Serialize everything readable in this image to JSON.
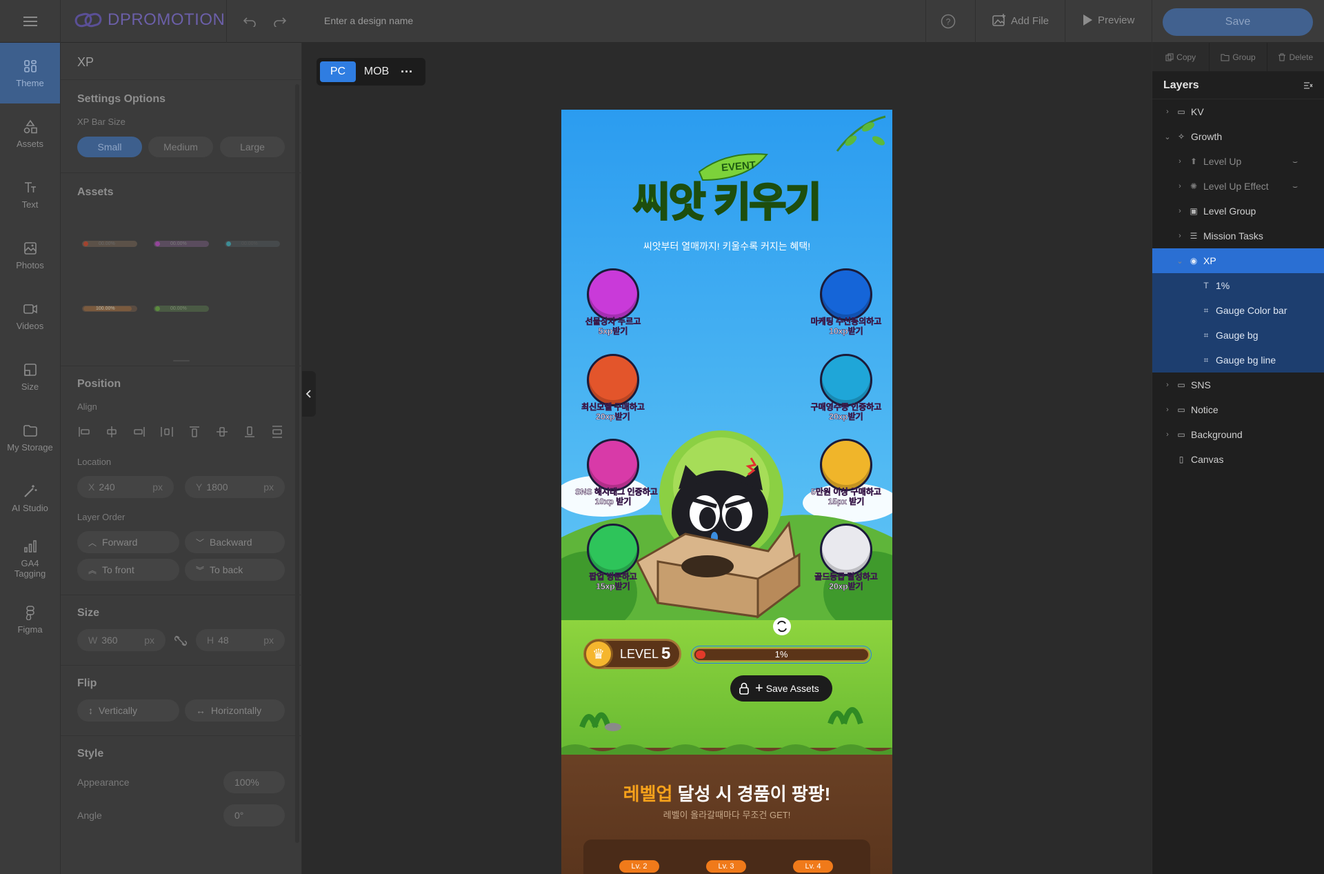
{
  "topbar": {
    "logo": "DPROMOTION",
    "design_name_placeholder": "Enter a design name",
    "add_file": "Add File",
    "preview": "Preview",
    "save": "Save"
  },
  "nav": [
    {
      "label": "Theme",
      "icon": "theme-icon"
    },
    {
      "label": "Assets",
      "icon": "assets-icon"
    },
    {
      "label": "Text",
      "icon": "text-icon"
    },
    {
      "label": "Photos",
      "icon": "photos-icon"
    },
    {
      "label": "Videos",
      "icon": "videos-icon"
    },
    {
      "label": "Size",
      "icon": "size-icon"
    },
    {
      "label": "My Storage",
      "icon": "folder-icon"
    },
    {
      "label": "AI Studio",
      "icon": "wand-icon"
    },
    {
      "label": "GA4 Tagging",
      "icon": "chart-icon"
    },
    {
      "label": "Figma",
      "icon": "figma-icon"
    }
  ],
  "panel": {
    "title": "XP",
    "settings_title": "Settings Options",
    "xp_bar_size_label": "XP Bar Size",
    "sizes": [
      "Small",
      "Medium",
      "Large"
    ],
    "selected_size": "Small",
    "assets_title": "Assets",
    "asset_labels": [
      "00.00%",
      "00.00%",
      "00.00%",
      "100.00%",
      "00.00%"
    ],
    "position_title": "Position",
    "align_label": "Align",
    "location_label": "Location",
    "x_label": "X",
    "x_value": "240",
    "y_label": "Y",
    "y_value": "1800",
    "unit": "px",
    "layer_order_label": "Layer Order",
    "forward": "Forward",
    "backward": "Backward",
    "to_front": "To front",
    "to_back": "To back",
    "size_title": "Size",
    "w_label": "W",
    "w_value": "360",
    "h_label": "H",
    "h_value": "48",
    "flip_title": "Flip",
    "vertically": "Vertically",
    "horizontally": "Horizontally",
    "style_title": "Style",
    "appearance_label": "Appearance",
    "appearance_value": "100%",
    "angle_label": "Angle",
    "angle_value": "0°"
  },
  "canvas": {
    "tab_pc": "PC",
    "tab_mob": "MOB",
    "more": "···"
  },
  "artboard": {
    "event": "EVENT",
    "title": "씨앗 키우기",
    "subtitle": "씨앗부터 열매까지! 키울수록 커지는 혜택!",
    "missions": [
      {
        "line1": "선물상자 누르고",
        "line2": "5xp받기",
        "color": "#c93ad9"
      },
      {
        "line1": "마케팅 수신동의하고",
        "line2": "10xp받기",
        "color": "#1565d8"
      },
      {
        "line1": "최신모델 구매하고",
        "line2": "20xp받기",
        "color": "#e3552b"
      },
      {
        "line1": "구매영수증 인증하고",
        "line2": "20xp받기",
        "color": "#1fa6d8"
      },
      {
        "line1": "SNS 해시태그 인증하고",
        "line2": "10xp 받기",
        "color": "#d83aa8"
      },
      {
        "line1": "5만원 이상 구매하고",
        "line2": "15px 받기",
        "color": "#f0b52a"
      },
      {
        "line1": "팝업 방문하고",
        "line2": "15xp받기",
        "color": "#2ec45a"
      },
      {
        "line1": "골드등급 달성하고",
        "line2": "20xp받기",
        "color": "#e9e9ee"
      }
    ],
    "level_text": "LEVEL",
    "level_num": "5",
    "xp_percent": "1%",
    "xp_fill": 0.01,
    "save_assets": "Save Assets",
    "reward_title_highlight": "레벨업",
    "reward_title_rest": " 달성 시 경품이 팡팡!",
    "reward_sub": "레벨이 올라갈때마다 무조건 GET!",
    "reward_levels": [
      "Lv. 2",
      "Lv. 3",
      "Lv. 4"
    ]
  },
  "right": {
    "copy": "Copy",
    "group": "Group",
    "delete": "Delete",
    "layers_title": "Layers",
    "layers": [
      {
        "label": "KV",
        "depth": 0,
        "chev": "›",
        "icon": "folder-icon",
        "state": ""
      },
      {
        "label": "Growth",
        "depth": 0,
        "chev": "⌄",
        "icon": "sparkle-icon",
        "state": ""
      },
      {
        "label": "Level Up",
        "depth": 1,
        "chev": "›",
        "icon": "levelup-icon",
        "state": "dim"
      },
      {
        "label": "Level Up Effect",
        "depth": 1,
        "chev": "›",
        "icon": "effect-icon",
        "state": "dim"
      },
      {
        "label": "Level Group",
        "depth": 1,
        "chev": "›",
        "icon": "level-group-icon",
        "state": ""
      },
      {
        "label": "Mission Tasks",
        "depth": 1,
        "chev": "›",
        "icon": "list-icon",
        "state": ""
      },
      {
        "label": "XP",
        "depth": 1,
        "chev": "⌄",
        "icon": "xp-icon",
        "state": "sel"
      },
      {
        "label": "1%",
        "depth": 2,
        "chev": "",
        "icon": "text-icon",
        "state": "child"
      },
      {
        "label": "Gauge Color bar",
        "depth": 2,
        "chev": "",
        "icon": "frame-icon",
        "state": "child"
      },
      {
        "label": "Gauge bg",
        "depth": 2,
        "chev": "",
        "icon": "frame-icon",
        "state": "child"
      },
      {
        "label": "Gauge bg line",
        "depth": 2,
        "chev": "",
        "icon": "frame-icon",
        "state": "child"
      },
      {
        "label": "SNS",
        "depth": 0,
        "chev": "›",
        "icon": "folder-icon",
        "state": ""
      },
      {
        "label": "Notice",
        "depth": 0,
        "chev": "›",
        "icon": "folder-icon",
        "state": ""
      },
      {
        "label": "Background",
        "depth": 0,
        "chev": "›",
        "icon": "folder-icon",
        "state": ""
      },
      {
        "label": "Canvas",
        "depth": 0,
        "chev": "",
        "icon": "canvas-icon",
        "state": ""
      }
    ]
  }
}
